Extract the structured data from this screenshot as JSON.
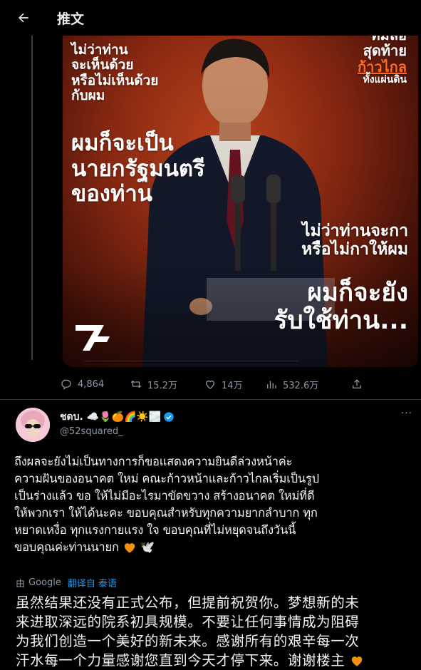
{
  "header": {
    "back_icon": "arrow-left-icon",
    "title": "推文"
  },
  "media": {
    "left_small": [
      "ไม่ว่าท่าน",
      "จะเห็นด้วย",
      "หรือไม่เห็นด้วย",
      "กับผม"
    ],
    "left_big": [
      "ผมก็จะเป็น",
      "นายกรัฐมนตรี",
      "ของท่าน"
    ],
    "right_top": [
      "ทีม่ลีอ",
      "สุดท้าย",
      "ก้าวไกล",
      "ทั้งแผ่นดิน"
    ],
    "right_mid": [
      "ไม่ว่าท่านจะกา",
      "หรือไม่กาให้ผม"
    ],
    "right_big": [
      "ผมก็จะยัง",
      "รับใช้ท่าน..."
    ],
    "accent": "#ff6a1e"
  },
  "actions": {
    "reply_count": "4,864",
    "retweet_count": "15.2万",
    "like_count": "14万",
    "views_count": "532.6万"
  },
  "reply": {
    "display_name": "ชดบ. ☁️🌷🍊🌈☀️🌫️",
    "handle": "@52squared_",
    "more": "···",
    "text_lines": [
      "ถึงผลจะยังไม่เป็นทางการก็ขอแสดงความยินดีล่วงหน้าค่ะ",
      "ความฝันของอนาคต ใหม่ คณะก้าวหน้าและก้าวไกลเริ่มเป็นรูป",
      "เป็นร่างแล้ว ขอ ให้ไม่มีอะไรมาขัดขวาง สร้างอนาคต ใหม่ที่ดี",
      "ให้พวกเรา ให้ได้นะคะ ขอบคุณสำหรับทุกความยากลำบาก ทุก",
      "หยาดเหงื่อ ทุกแรงกายแรง ใจ ขอบคุณที่ไม่หยุดจนถึงวันนี้",
      "ขอบคุณค่ะท่านนายก"
    ],
    "dove": "🕊️",
    "translated_prefix": "由",
    "translated_provider": "Google",
    "translated_link": "翻译自 泰语",
    "translation_lines": [
      "虽然结果还没有正式公布，但提前祝贺你。梦想新的未",
      "来进取深远的院系初具规模。不要让任何事情成为阻碍",
      "为我们创造一个美好的新未来。感谢所有的艰辛每一次",
      "汗水每一个力量感谢您直到今天才停下来。谢谢楼主"
    ],
    "verified_color": "#1d9bf0",
    "heart_color": "#f4900c"
  }
}
